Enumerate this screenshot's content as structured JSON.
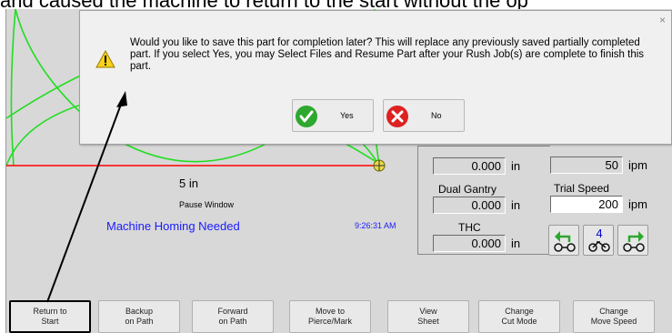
{
  "doc_caption": "and caused the machine to return to the start without the op",
  "plot": {
    "dimension_label": "5 in",
    "pause_label": "Pause Window",
    "status_text": "Machine Homing Needed",
    "time": "9:26:31 AM"
  },
  "panel": {
    "field_top": {
      "value": "0.000",
      "unit": "in"
    },
    "dual_gantry": {
      "label": "Dual Gantry",
      "value": "0.000",
      "unit": "in"
    },
    "thc": {
      "label": "THC",
      "value": "0.000",
      "unit": "in"
    },
    "speed_top": {
      "value": "50",
      "unit": "ipm"
    },
    "trial_speed": {
      "label": "Trial Speed",
      "value": "200",
      "unit": "ipm"
    },
    "step_number": "4"
  },
  "dialog": {
    "close": "×",
    "message": "Would you like to save this part for completion later? This will replace any previously saved partially completed part. If you select Yes, you may Select Files and Resume Part after your Rush Job(s) are complete to finish this part.",
    "yes_label": "Yes",
    "no_label": "No"
  },
  "buttons": [
    "Return to\nStart",
    "Backup\non Path",
    "Forward\non Path",
    "Move to\nPierce/Mark",
    "View\nSheet",
    "Change\nCut Mode",
    "Change\nMove Speed"
  ],
  "colors": {
    "path_green": "#22dd22",
    "path_red": "#ff0000",
    "status_blue": "#1a1aff",
    "yes_green": "#2ea82e",
    "no_red": "#dd2222"
  }
}
